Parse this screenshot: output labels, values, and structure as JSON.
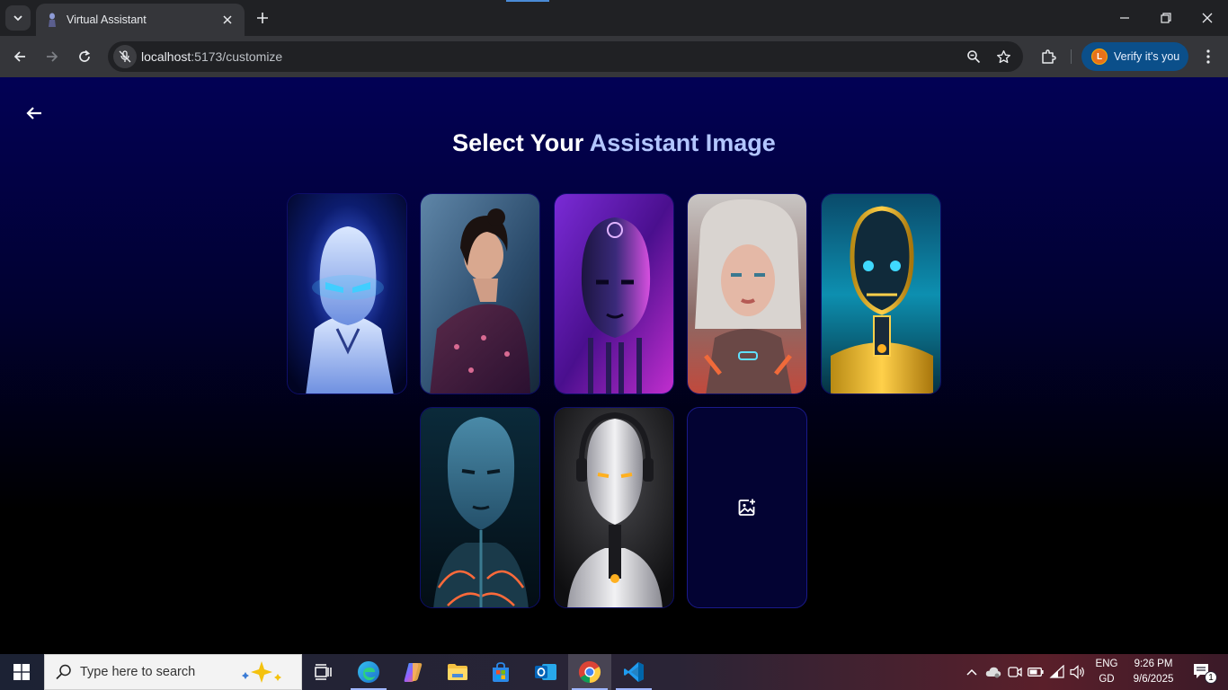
{
  "browser": {
    "tab_title": "Virtual Assistant",
    "url_host": "localhost",
    "url_path": ":5173/customize",
    "verify_label": "Verify it's you",
    "profile_initial": "L"
  },
  "page": {
    "heading_prefix": "Select Your ",
    "heading_accent": "Assistant Image",
    "cards": [
      {
        "subject": "blue-glowing-robot"
      },
      {
        "subject": "woman-in-patterned-dress"
      },
      {
        "subject": "purple-cyborg-head"
      },
      {
        "subject": "woman-with-silver-hair"
      },
      {
        "subject": "gold-blue-robot"
      },
      {
        "subject": "blue-cyborg-woman"
      },
      {
        "subject": "white-android-with-headphones"
      }
    ],
    "upload_icon": "image-add-icon"
  },
  "taskbar": {
    "search_placeholder": "Type here to search",
    "language_top": "ENG",
    "language_bottom": "GD",
    "time": "9:26 PM",
    "date": "9/6/2025",
    "notification_count": "1"
  },
  "colors": {
    "accent_heading": "#b3c6ff",
    "page_top": "#020155",
    "page_bottom": "#000000"
  }
}
